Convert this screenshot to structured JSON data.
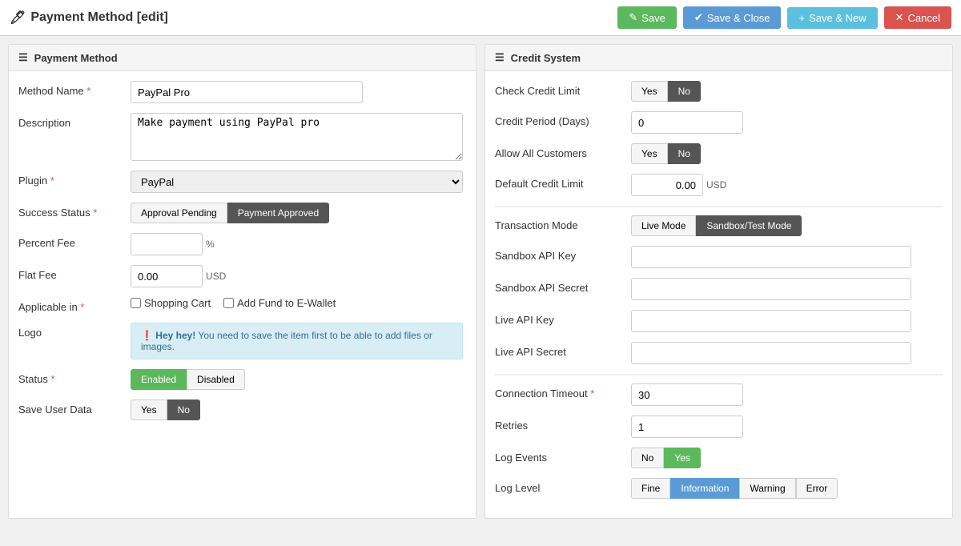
{
  "page": {
    "title": "Payment Method [edit]",
    "icon": "💳"
  },
  "toolbar": {
    "save_label": "Save",
    "save_close_label": "Save & Close",
    "save_new_label": "Save & New",
    "cancel_label": "Cancel"
  },
  "left_panel": {
    "header": "Payment Method",
    "fields": {
      "method_name_label": "Method Name",
      "method_name_value": "PayPal Pro",
      "description_label": "Description",
      "description_value": "Make payment using PayPal pro",
      "plugin_label": "Plugin",
      "plugin_value": "PayPal",
      "success_status_label": "Success Status",
      "success_status_btn1": "Approval Pending",
      "success_status_btn2": "Payment Approved",
      "percent_fee_label": "Percent Fee",
      "percent_fee_value": "",
      "percent_suffix": "%",
      "flat_fee_label": "Flat Fee",
      "flat_fee_value": "0.00",
      "flat_fee_suffix": "USD",
      "applicable_label": "Applicable in",
      "shopping_cart_label": "Shopping Cart",
      "add_fund_label": "Add Fund to E-Wallet",
      "logo_label": "Logo",
      "alert_text_bold": "Hey hey!",
      "alert_text": " You need to save the item first to be able to add files or images.",
      "status_label": "Status",
      "status_btn1": "Enabled",
      "status_btn2": "Disabled",
      "save_user_data_label": "Save User Data",
      "save_user_yes": "Yes",
      "save_user_no": "No"
    }
  },
  "right_panel": {
    "header": "Credit System",
    "credit_section": {
      "check_credit_label": "Check Credit Limit",
      "check_credit_yes": "Yes",
      "check_credit_no": "No",
      "credit_period_label": "Credit Period (Days)",
      "credit_period_value": "0",
      "allow_all_label": "Allow All Customers",
      "allow_all_yes": "Yes",
      "allow_all_no": "No",
      "default_credit_label": "Default Credit Limit",
      "default_credit_value": "0.00",
      "default_credit_suffix": "USD"
    },
    "transaction_section": {
      "transaction_mode_label": "Transaction Mode",
      "live_mode_label": "Live Mode",
      "sandbox_mode_label": "Sandbox/Test Mode",
      "sandbox_api_key_label": "Sandbox API Key",
      "sandbox_api_key_value": "",
      "sandbox_api_secret_label": "Sandbox API Secret",
      "sandbox_api_secret_value": "",
      "live_api_key_label": "Live API Key",
      "live_api_key_value": "",
      "live_api_secret_label": "Live API Secret",
      "live_api_secret_value": ""
    },
    "connection_section": {
      "connection_timeout_label": "Connection Timeout",
      "connection_timeout_value": "30",
      "retries_label": "Retries",
      "retries_value": "1",
      "log_events_label": "Log Events",
      "log_events_no": "No",
      "log_events_yes": "Yes",
      "log_level_label": "Log Level",
      "log_level_fine": "Fine",
      "log_level_information": "Information",
      "log_level_warning": "Warning",
      "log_level_error": "Error"
    }
  }
}
